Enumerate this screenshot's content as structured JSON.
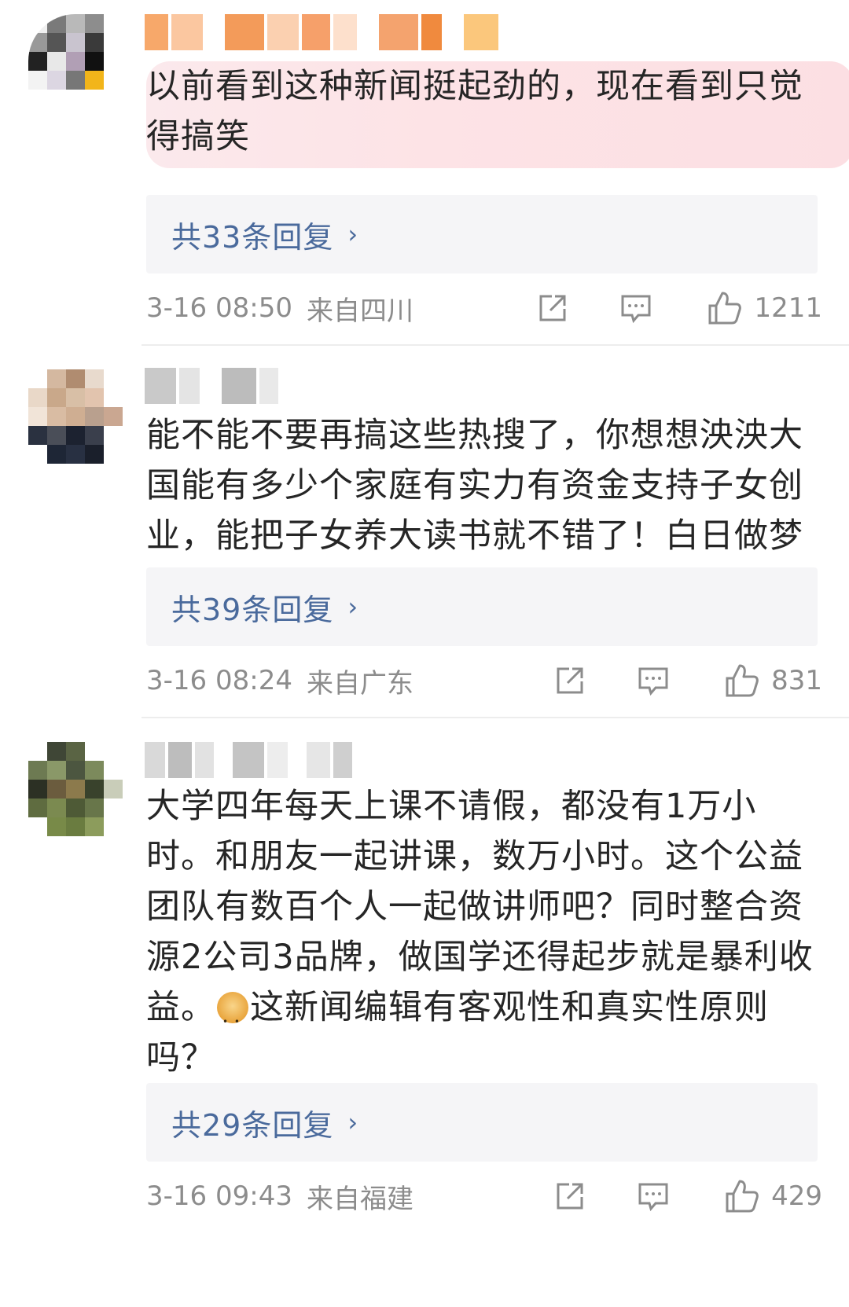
{
  "comments": [
    {
      "text": "以前看到这种新闻挺起劲的，现在看到只觉得搞笑",
      "replies": "共33条回复",
      "time": "3-16 08:50",
      "location": "来自四川",
      "likes": "1211",
      "highlighted": true
    },
    {
      "text": "能不能不要再搞这些热搜了，你想想泱泱大国能有多少个家庭有实力有资金支持子女创业，能把子女养大读书就不错了！白日做梦",
      "replies": "共39条回复",
      "time": "3-16 08:24",
      "location": "来自广东",
      "likes": "831",
      "highlighted": false
    },
    {
      "text_before_emoji": "大学四年每天上课不请假，都没有1万小时。和朋友一起讲课，数万小时。这个公益团队有数百个人一起做讲师吧？同时整合资源2公司3品牌，做国学还得起步就是暴利收益。",
      "text_after_emoji": "这新闻编辑有客观性和真实性原则吗？",
      "emoji": "doge-emoji",
      "replies": "共29条回复",
      "time": "3-16 09:43",
      "location": "来自福建",
      "likes": "429",
      "highlighted": false
    }
  ],
  "icons": {
    "share": "share-icon",
    "comment": "comment-icon",
    "like": "thumbs-up-icon",
    "chevron": "›"
  },
  "colors": {
    "reply_link": "#4a6a9c",
    "meta_text": "#8c8c8c",
    "reply_bg": "#f5f5f7",
    "highlight": "#fde3e6"
  }
}
